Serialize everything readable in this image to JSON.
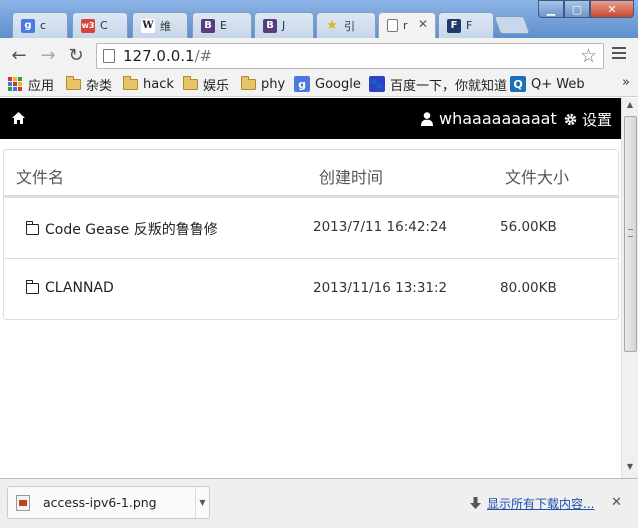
{
  "browser": {
    "tabs": [
      {
        "favicon": "g",
        "favicon_color": "#4a7ae0",
        "title": "c"
      },
      {
        "favicon": "w3",
        "favicon_color": "#d7463b",
        "title": "C"
      },
      {
        "favicon": "W",
        "favicon_color": "#ffffff",
        "title": "维"
      },
      {
        "favicon": "B",
        "favicon_color": "#563d7c",
        "title": "E"
      },
      {
        "favicon": "B",
        "favicon_color": "#563d7c",
        "title": "J"
      },
      {
        "favicon": "★",
        "favicon_color": "#e2b422",
        "title": "引"
      },
      {
        "favicon": "page",
        "favicon_color": "#ffffff",
        "title": "r"
      },
      {
        "favicon": "F",
        "favicon_color": "#203a68",
        "title": "F"
      }
    ],
    "active_tab_index": 6,
    "url_host": "127.0.0.1",
    "url_path": "/#",
    "bookmarks": [
      {
        "label": "应用",
        "icon": "apps-grid-icon"
      },
      {
        "label": "杂类",
        "icon": "folder-icon"
      },
      {
        "label": "hack",
        "icon": "folder-icon"
      },
      {
        "label": "娱乐",
        "icon": "folder-icon"
      },
      {
        "label": "phy",
        "icon": "folder-icon"
      },
      {
        "label": "Google",
        "icon": "google-icon"
      },
      {
        "label": "百度一下，你就知道",
        "icon": "baidu-paw-icon"
      },
      {
        "label": "Q+ Web",
        "icon": "qplus-icon"
      }
    ],
    "bookmarks_overflow": "»"
  },
  "navbar": {
    "username": "whaaaaaaaaat",
    "settings_label": "设置"
  },
  "file_table": {
    "headers": {
      "name": "文件名",
      "created": "创建时间",
      "size": "文件大小"
    },
    "rows": [
      {
        "name": "Code Gease 反叛的鲁鲁修",
        "created": "2013/7/11 16:42:24",
        "size": "56.00KB"
      },
      {
        "name": "CLANNAD",
        "created": "2013/11/16 13:31:2",
        "size": "80.00KB"
      }
    ]
  },
  "download_shelf": {
    "file_name": "access-ipv6-1.png",
    "show_all_label": "显示所有下载内容...",
    "close_label": "✕"
  },
  "colors": {
    "navbar_bg": "#000000",
    "link": "#1a4fb0",
    "tabstrip": "#6f9bd0"
  }
}
